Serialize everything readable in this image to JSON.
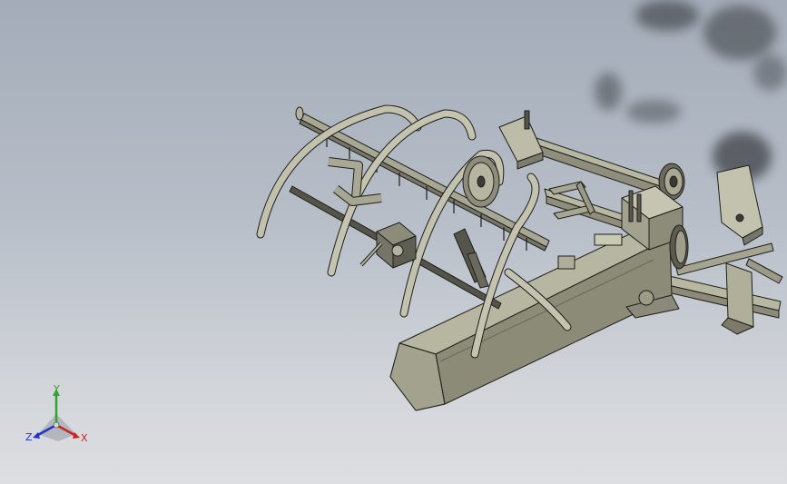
{
  "viewport": {
    "background_top": "#a3acb8",
    "background_bottom": "#dcdee1",
    "model_color": "#b5b49f",
    "model_dark": "#6d6c5c",
    "edge_color": "#1e1e1a"
  },
  "triad": {
    "x_label": "X",
    "y_label": "Y",
    "z_label": "Z",
    "x_color": "#cc2222",
    "y_color": "#2fa52f",
    "z_color": "#2233cc"
  }
}
